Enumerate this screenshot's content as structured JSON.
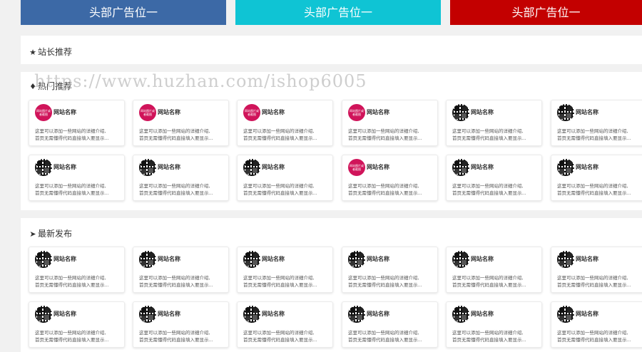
{
  "ads": [
    {
      "label": "头部广告位一",
      "color": "#3c69a6"
    },
    {
      "label": "头部广告位一",
      "color": "#0fc4d4"
    },
    {
      "label": "头部广告位一",
      "color": "#c30000"
    }
  ],
  "sections": {
    "recommend": {
      "title": "站长推荐",
      "icon": "star-icon"
    },
    "hot": {
      "title": "热门推荐",
      "icon": "fire-icon"
    },
    "latest": {
      "title": "最新发布",
      "icon": "paper-plane-icon"
    }
  },
  "watermark": "https://www.huzhan.com/ishop6005",
  "card_defaults": {
    "name": "网站名称",
    "desc_line1": "这里可以添加一些网站的详细介绍,",
    "desc_line2": "首页无需懂得代码直接填入要显示..."
  },
  "hot_cards": [
    {
      "logo": "pink",
      "logo_text": "网站图片或者截图"
    },
    {
      "logo": "pink",
      "logo_text": "网站图片或者截图"
    },
    {
      "logo": "pink",
      "logo_text": "网站图片或者截图"
    },
    {
      "logo": "pink",
      "logo_text": "网站图片或者截图"
    },
    {
      "logo": "qr"
    },
    {
      "logo": "qr"
    },
    {
      "logo": "qr"
    },
    {
      "logo": "qr"
    },
    {
      "logo": "qr"
    },
    {
      "logo": "pink",
      "logo_text": "网站图片或者截图"
    },
    {
      "logo": "qr"
    },
    {
      "logo": "qr"
    }
  ],
  "latest_cards": [
    {
      "logo": "qr"
    },
    {
      "logo": "qr"
    },
    {
      "logo": "qr"
    },
    {
      "logo": "qr"
    },
    {
      "logo": "qr"
    },
    {
      "logo": "qr"
    },
    {
      "logo": "qr"
    },
    {
      "logo": "qr"
    },
    {
      "logo": "qr"
    },
    {
      "logo": "qr"
    },
    {
      "logo": "qr"
    },
    {
      "logo": "qr"
    }
  ]
}
